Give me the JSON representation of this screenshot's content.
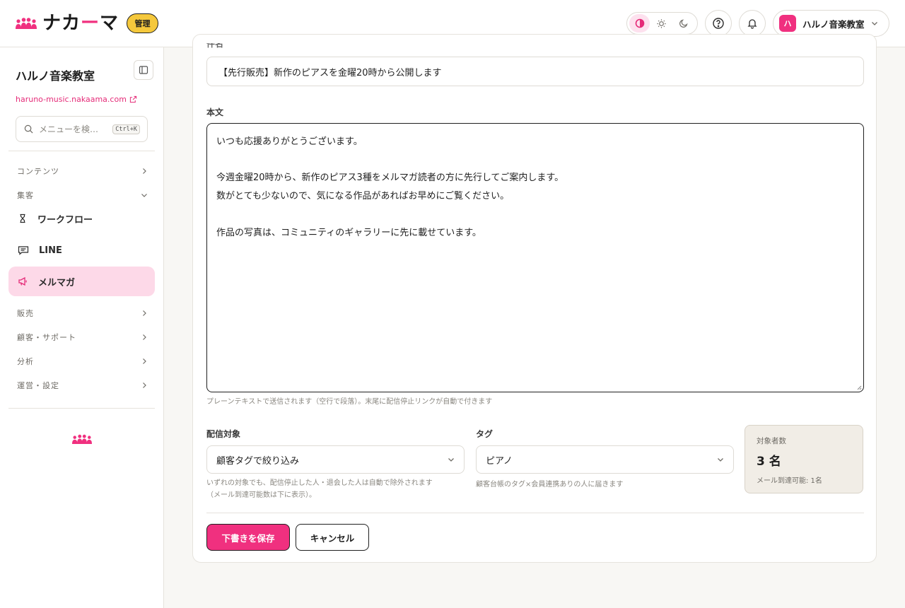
{
  "brand": {
    "logo_text_a": "ナカ",
    "logo_text_b": "ー",
    "logo_text_c": "マ",
    "admin_badge": "管理",
    "accent_color": "#f0307f"
  },
  "header": {
    "theme_buttons": [
      "contrast-icon",
      "sun-icon",
      "moon-icon"
    ],
    "account_avatar": "ハ",
    "account_name": "ハルノ音楽教室"
  },
  "sidebar": {
    "title": "ハルノ音楽教室",
    "url": "haruno-music.nakaama.com",
    "search_placeholder": "メニューを検…",
    "search_shortcut": "Ctrl+K",
    "groups": {
      "contents": "コンテンツ",
      "marketing": "集客",
      "sales": "販売",
      "customers": "顧客・サポート",
      "analytics": "分析",
      "settings": "運営・設定"
    },
    "items": {
      "workflow": "ワークフロー",
      "line": "LINE",
      "newsletter": "メルマガ"
    }
  },
  "form": {
    "subject_label": "件名",
    "subject_value": "【先行販売】新作のピアスを金曜20時から公開します",
    "body_label": "本文",
    "body_value": "いつも応援ありがとうございます。\n\n今週金曜20時から、新作のピアス3種をメルマガ読者の方に先行してご案内します。\n数がとても少ないので、気になる作品があればお早めにご覧ください。\n\n作品の写真は、コミュニティのギャラリーに先に載せています。",
    "body_hint": "プレーンテキストで送信されます（空行で段落）。末尾に配信停止リンクが自動で付きます",
    "target_label": "配信対象",
    "target_value": "顧客タグで絞り込み",
    "target_hint_1": "いずれの対象でも、配信停止した人・退会した人は自動で除外されます",
    "target_hint_2": "（メール到達可能数は下に表示）。",
    "tag_label": "タグ",
    "tag_value": "ピアノ",
    "tag_hint": "顧客台帳のタグ×会員連携ありの人に届きます",
    "count_label": "対象者数",
    "count_value": "3 名",
    "count_sub": "メール到達可能: 1名",
    "save_button": "下書きを保存",
    "cancel_button": "キャンセル"
  }
}
